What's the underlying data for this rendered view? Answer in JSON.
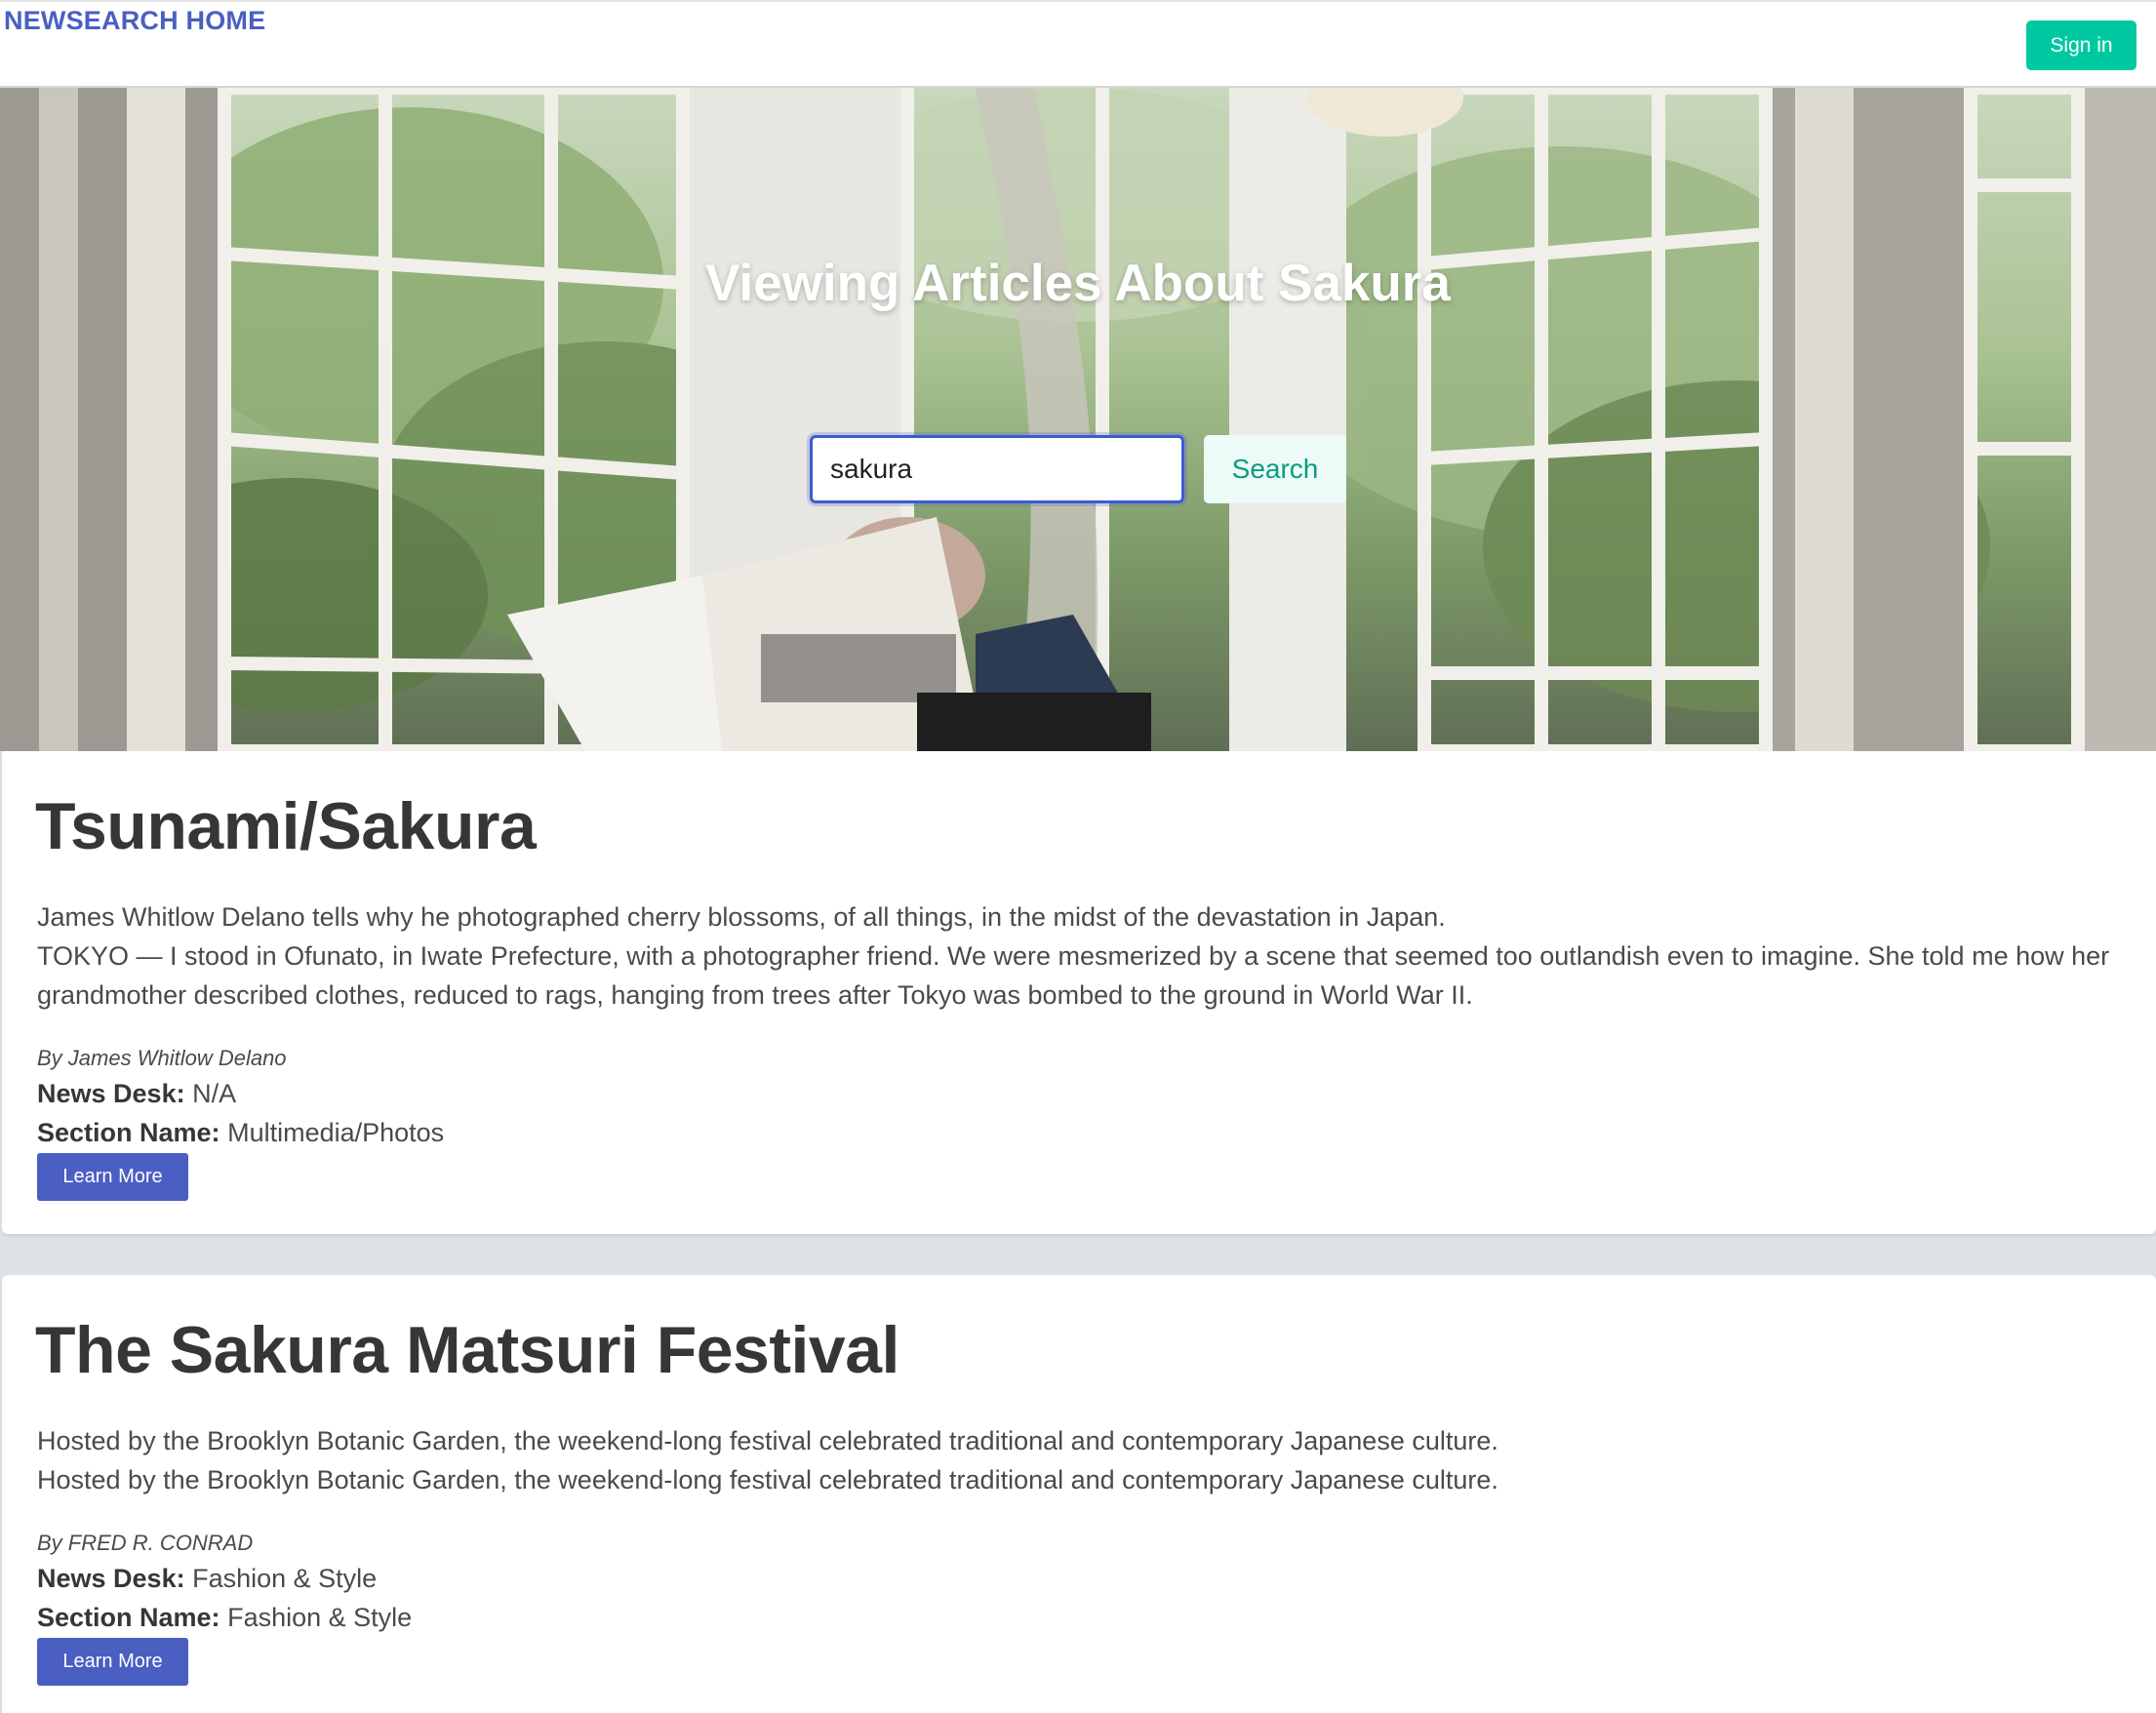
{
  "navbar": {
    "brand": "NEWSEARCH HOME",
    "signin_label": "Sign in"
  },
  "hero": {
    "title": "Viewing Articles About Sakura",
    "search_value": "sakura",
    "search_button": "Search"
  },
  "labels": {
    "news_desk": "News Desk:",
    "section_name": "Section Name:",
    "learn_more": "Learn More"
  },
  "articles": [
    {
      "title": "Tsunami/Sakura",
      "abstract_line1": "James Whitlow Delano tells why he photographed cherry blossoms, of all things, in the midst of the devastation in Japan.",
      "abstract_line2": "TOKYO — I stood in Ofunato, in Iwate Prefecture, with a photographer friend. We were mesmerized by a scene that seemed too outlandish even to imagine. She told me how her grandmother described clothes, reduced to rags, hanging from trees after Tokyo was bombed to the ground in World War II.",
      "byline": "By James Whitlow Delano",
      "news_desk": "N/A",
      "section_name": "Multimedia/Photos"
    },
    {
      "title": "The Sakura Matsuri Festival",
      "abstract_line1": "Hosted by the Brooklyn Botanic Garden, the weekend-long festival celebrated traditional and contemporary Japanese culture.",
      "abstract_line2": "Hosted by the Brooklyn Botanic Garden, the weekend-long festival celebrated traditional and contemporary Japanese culture.",
      "byline": "By FRED R. CONRAD",
      "news_desk": "Fashion & Style",
      "section_name": "Fashion & Style"
    }
  ],
  "colors": {
    "brand": "#4a5fc1",
    "signin": "#00c9a2",
    "search_text": "#0d9b7e",
    "learn_more": "#4a5fc1"
  }
}
